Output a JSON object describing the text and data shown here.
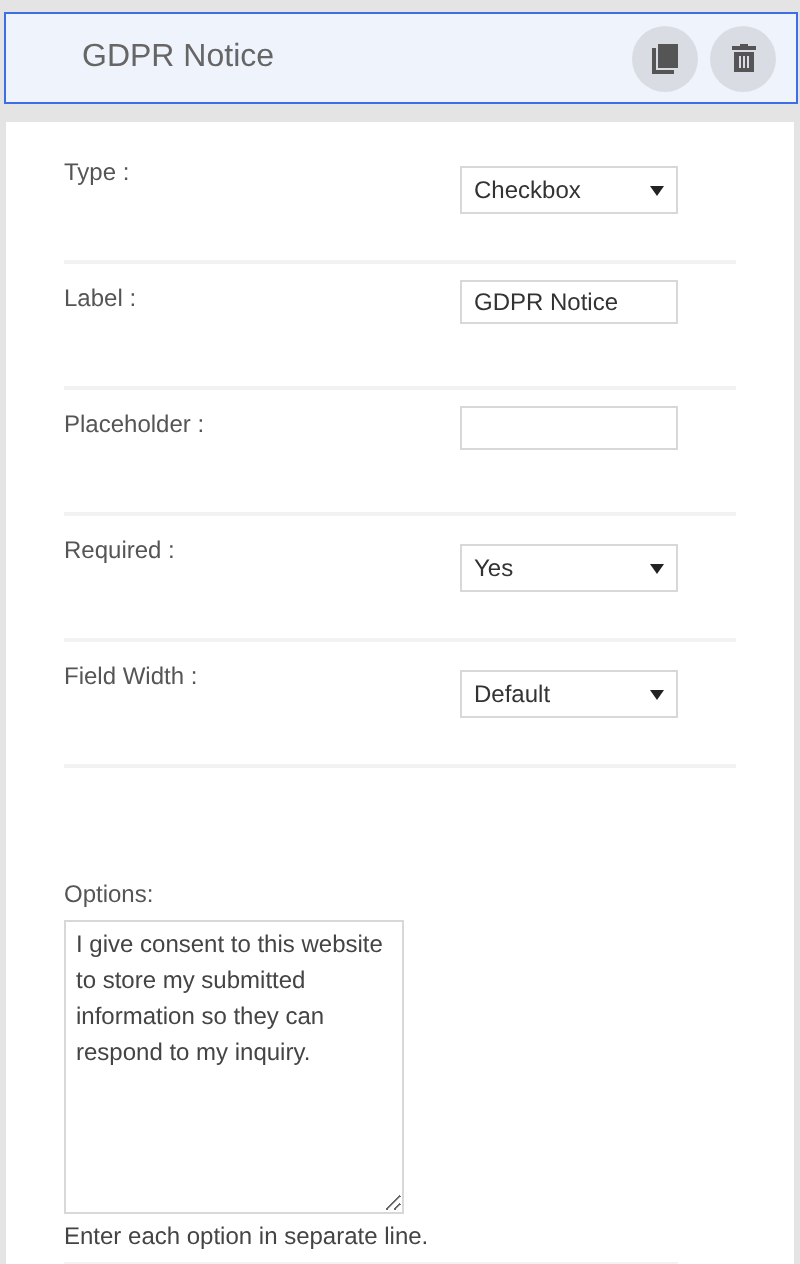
{
  "header": {
    "title": "GDPR Notice"
  },
  "fields": [
    {
      "label": "Type :",
      "kind": "select",
      "value": "Checkbox"
    },
    {
      "label": "Label :",
      "kind": "text",
      "value": "GDPR Notice"
    },
    {
      "label": "Placeholder :",
      "kind": "text"
    },
    {
      "label": "Required :",
      "kind": "select",
      "value": "Yes"
    },
    {
      "label": "Field Width :",
      "kind": "select",
      "value": "Default"
    }
  ],
  "options": {
    "label": "Options:",
    "value": "I give consent to this website to store my submitted information so they can respond to my inquiry.",
    "hint": "Enter each option in separate line."
  }
}
